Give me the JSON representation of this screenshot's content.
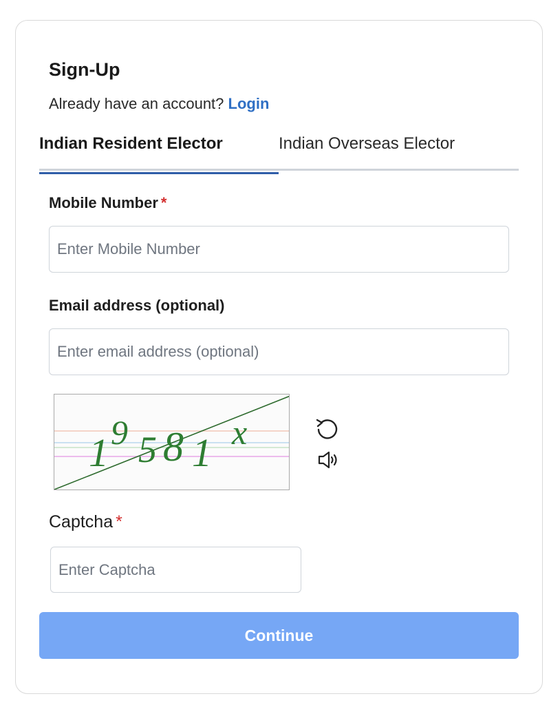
{
  "form": {
    "title": "Sign-Up",
    "login_prompt": "Already have an account?",
    "login_link": "Login"
  },
  "tabs": [
    {
      "label": "Indian Resident Elector",
      "active": true
    },
    {
      "label": "Indian Overseas Elector",
      "active": false
    }
  ],
  "mobile": {
    "label": "Mobile Number",
    "required_mark": "*",
    "placeholder": "Enter Mobile Number",
    "value": ""
  },
  "email": {
    "label": "Email address (optional)",
    "placeholder": "Enter email address (optional)",
    "value": ""
  },
  "captcha": {
    "image_text": "19581x",
    "refresh_icon": "refresh-icon",
    "audio_icon": "speaker-icon",
    "label": "Captcha",
    "required_mark": "*",
    "placeholder": "Enter Captcha",
    "value": ""
  },
  "actions": {
    "continue_label": "Continue"
  },
  "colors": {
    "link": "#2f6fc4",
    "active_tab_underline": "#2f5da8",
    "required": "#d32f2f",
    "continue_bg": "#76a7f5",
    "captcha_text": "#2e7d32"
  }
}
